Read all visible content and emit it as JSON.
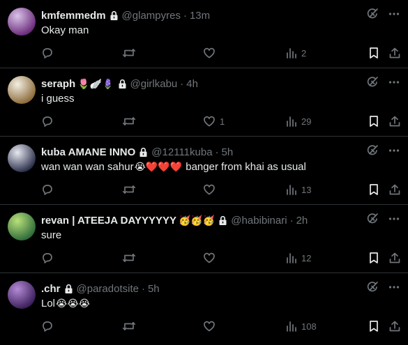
{
  "posts": [
    {
      "name": "kmfemmedm",
      "name_emojis": "",
      "handle": "@glampyres",
      "separator": "·",
      "time": "13m",
      "text": "Okay man",
      "text_emojis": "",
      "text_suffix": "",
      "avatar_colors": [
        "#d9c3e8",
        "#6a2a7a"
      ],
      "replies": "",
      "reposts": "",
      "likes": "",
      "views": "2"
    },
    {
      "name": "seraph",
      "name_emojis": "🌷🪽🪻",
      "handle": "@girlkabu",
      "separator": "·",
      "time": "4h",
      "text": "i guess",
      "text_emojis": "",
      "text_suffix": "",
      "avatar_colors": [
        "#f3efe4",
        "#8c6b3a"
      ],
      "replies": "",
      "reposts": "",
      "likes": "1",
      "views": "29"
    },
    {
      "name": "kuba AMANE INNO",
      "name_emojis": "",
      "handle": "@12111kuba",
      "separator": "·",
      "time": "5h",
      "text": "wan wan wan sahur",
      "text_emojis": "😭❤️❤️❤️",
      "text_suffix": "banger from khai as usual",
      "avatar_colors": [
        "#e6e8f0",
        "#2b2f4a"
      ],
      "replies": "",
      "reposts": "",
      "likes": "",
      "views": "13"
    },
    {
      "name": "revan | ATEEJA DAYYYYYY",
      "name_emojis": "🥳🥳🥳",
      "handle": "@habibinari",
      "separator": "·",
      "time": "2h",
      "text": "sure",
      "text_emojis": "",
      "text_suffix": "",
      "avatar_colors": [
        "#b9e07a",
        "#2f6b3a"
      ],
      "replies": "",
      "reposts": "",
      "likes": "",
      "views": "12"
    },
    {
      "name": ".chr",
      "name_emojis": "",
      "handle": "@paradotsite",
      "separator": "·",
      "time": "5h",
      "text": "Lol",
      "text_emojis": "😭😭😭",
      "text_suffix": "",
      "avatar_colors": [
        "#b48ad6",
        "#3b1f5a"
      ],
      "replies": "",
      "reposts": "",
      "likes": "",
      "views": "108"
    }
  ],
  "icons": {
    "lock": "lock-icon",
    "grok": "grok-icon",
    "more": "more-icon",
    "reply": "reply-icon",
    "repost": "repost-icon",
    "like": "heart-icon",
    "views": "views-icon",
    "bookmark": "bookmark-icon",
    "share": "share-icon"
  },
  "colors": {
    "background": "#000000",
    "divider": "#2f3336",
    "primary_text": "#e7e9ea",
    "secondary_text": "#71767b"
  }
}
